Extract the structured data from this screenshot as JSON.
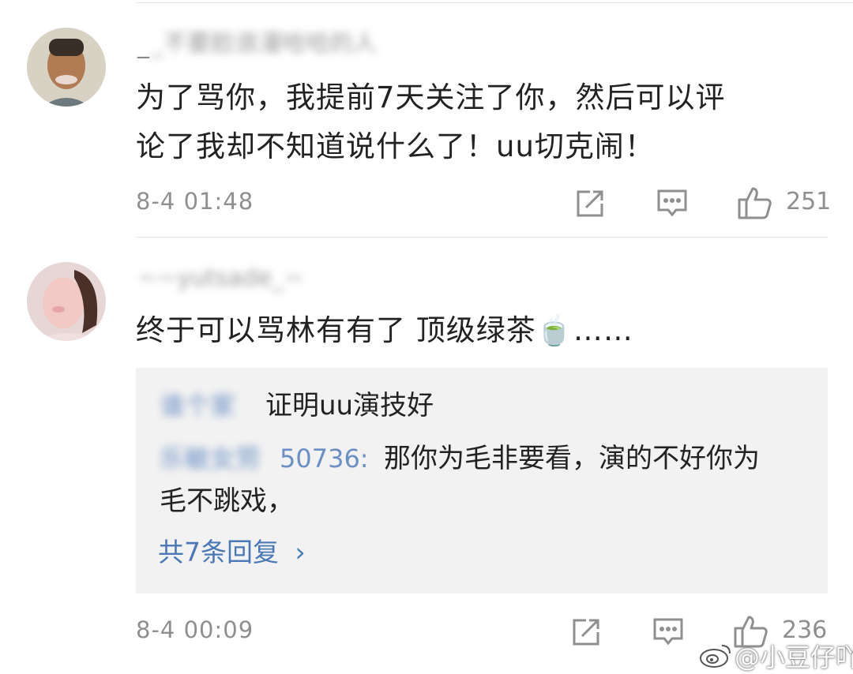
{
  "comments": [
    {
      "username": "_不要脸浪漫哈哈的人",
      "text_line1": "为了骂你，我提前7天关注了你，然后可以评",
      "text_line2": "论了我却不知道说什么了！uu切克闹！",
      "time": "8-4 01:48",
      "likes": "251"
    },
    {
      "username": "~~yutsade_~",
      "text": "终于可以骂林有有了 顶级绿茶",
      "emoji": "🍵",
      "ellipsis": "……",
      "time": "8-4 00:09",
      "likes": "236",
      "replies": [
        {
          "name": "谁个家",
          "text": "证明uu演技好"
        },
        {
          "name": "乐敏女劳",
          "name_tail": "50736:",
          "text_line1": "那你为毛非要看，演的不好你为",
          "text_line2": "毛不跳戏，"
        }
      ],
      "more_replies": "共7条回复",
      "more_replies_arrow": "›"
    }
  ],
  "watermark": "@小豆仔吖",
  "icons": {
    "share": "share-icon",
    "comment": "comment-icon",
    "like": "thumbs-up-icon",
    "weibo": "weibo-logo-icon"
  },
  "colors": {
    "link": "#4a78b6",
    "meta": "#8f8f8f",
    "text": "#222222",
    "reply_bg": "#f2f2f2"
  }
}
